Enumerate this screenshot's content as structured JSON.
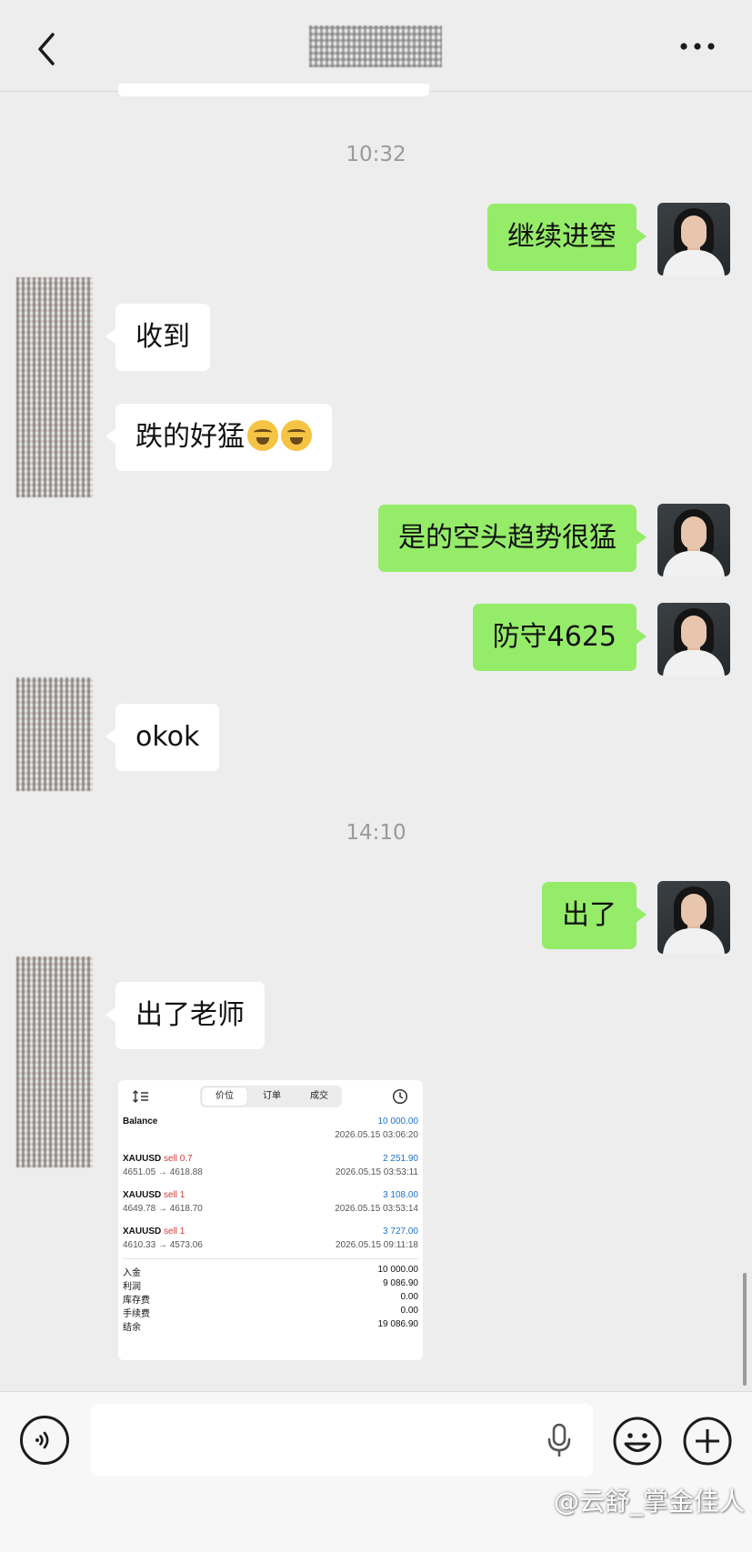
{
  "header": {
    "back_icon": "chevron-left-icon",
    "more_icon": "ellipsis-icon"
  },
  "timestamps": [
    "10:32",
    "14:10"
  ],
  "messages": [
    {
      "side": "right",
      "text": "继续进箜"
    },
    {
      "side": "left",
      "text": "收到"
    },
    {
      "side": "left",
      "text": "跌的好猛",
      "emojis": [
        "facepalm-laugh-emoji",
        "facepalm-laugh-emoji"
      ]
    },
    {
      "side": "right",
      "text": "是的空头趋势很猛"
    },
    {
      "side": "right",
      "text": "防守4625"
    },
    {
      "side": "left",
      "text": "okok"
    },
    {
      "side": "right",
      "text": "出了"
    },
    {
      "side": "left",
      "text": "出了老师"
    }
  ],
  "trade_screenshot": {
    "tabs": [
      "价位",
      "订单",
      "成交"
    ],
    "active_tab": "价位",
    "balance": {
      "label": "Balance",
      "amount": "10 000.00",
      "time": "2026.05.15 03:06:20"
    },
    "deals": [
      {
        "symbol": "XAUUSD",
        "side": "sell 0.7",
        "profit": "2 251.90",
        "prices": "4651.05 → 4618.88",
        "time": "2026.05.15 03:53:11"
      },
      {
        "symbol": "XAUUSD",
        "side": "sell 1",
        "profit": "3 108.00",
        "prices": "4649.78 → 4618.70",
        "time": "2026.05.15 03:53:14"
      },
      {
        "symbol": "XAUUSD",
        "side": "sell 1",
        "profit": "3 727.00",
        "prices": "4610.33 → 4573.06",
        "time": "2026.05.15 09:11:18"
      }
    ],
    "summary": [
      {
        "label": "入金",
        "value": "10 000.00"
      },
      {
        "label": "利润",
        "value": "9 086.90"
      },
      {
        "label": "库存费",
        "value": "0.00"
      },
      {
        "label": "手续费",
        "value": "0.00"
      },
      {
        "label": "结余",
        "value": "19 086.90"
      }
    ]
  },
  "input_bar": {
    "voice_icon": "voice-icon",
    "mic_icon": "microphone-icon",
    "emoji_icon": "smiley-icon",
    "plus_icon": "plus-icon"
  },
  "watermark": "@云舒_掌金佳人"
}
